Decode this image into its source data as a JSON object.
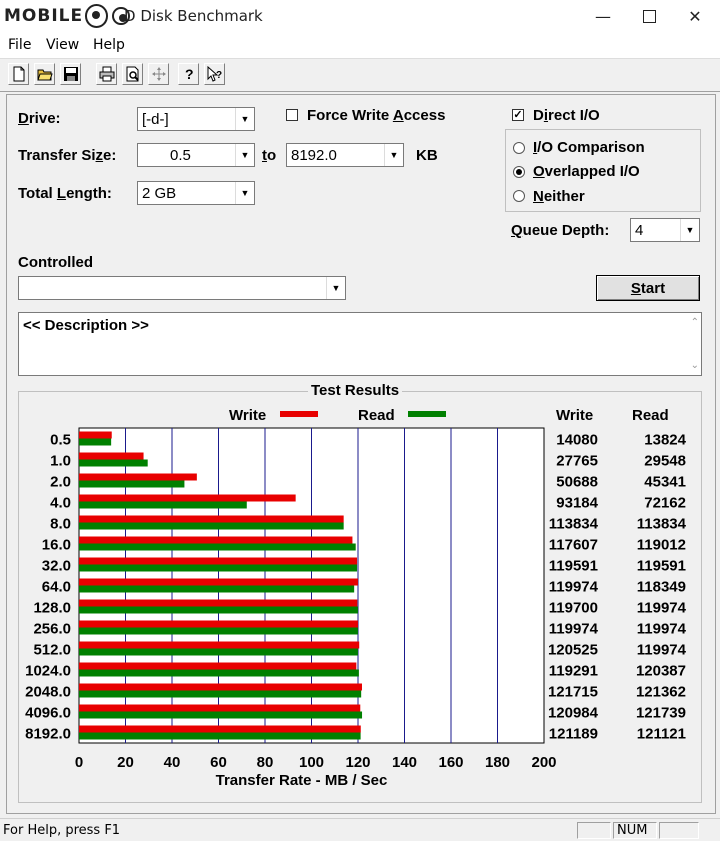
{
  "window": {
    "title": "D Disk Benchmark"
  },
  "menu": {
    "file": "File",
    "view": "View",
    "help": "Help"
  },
  "toolbar_icons": [
    "new-icon",
    "open-icon",
    "save-icon",
    "print-icon",
    "print-preview-icon",
    "move-icon",
    "help-icon",
    "context-help-icon"
  ],
  "settings": {
    "drive_label": "Drive:",
    "drive_value": "[-d-]",
    "force_write_label": "Force Write Access",
    "force_write_checked": false,
    "direct_io_label": "Direct I/O",
    "direct_io_checked": true,
    "transfer_size_label": "Transfer Size:",
    "transfer_from": "0.5",
    "to_label": "to",
    "transfer_to": "8192.0",
    "kb_label": "KB",
    "total_length_label": "Total Length:",
    "total_length_value": "2 GB",
    "io_comparison": "I/O Comparison",
    "overlapped_io": "Overlapped I/O",
    "neither": "Neither",
    "selected_mode": "Overlapped I/O",
    "queue_depth_label": "Queue Depth:",
    "queue_depth_value": "4",
    "controlled_label": "Controlled",
    "controlled_value": "",
    "start_label": "Start",
    "description": "<< Description >>"
  },
  "results": {
    "group_title": "Test Results",
    "write_header": "Write",
    "read_header": "Read"
  },
  "chart_data": {
    "type": "bar",
    "orientation": "horizontal",
    "categories": [
      "0.5",
      "1.0",
      "2.0",
      "4.0",
      "8.0",
      "16.0",
      "32.0",
      "64.0",
      "128.0",
      "256.0",
      "512.0",
      "1024.0",
      "2048.0",
      "4096.0",
      "8192.0"
    ],
    "series": [
      {
        "name": "Write",
        "color": "#e80000",
        "values": [
          14080,
          27765,
          50688,
          93184,
          113834,
          117607,
          119591,
          119974,
          119700,
          119974,
          120525,
          119291,
          121715,
          120984,
          121189
        ]
      },
      {
        "name": "Read",
        "color": "#008000",
        "values": [
          13824,
          29548,
          45341,
          72162,
          113834,
          119012,
          119591,
          118349,
          119974,
          119974,
          119974,
          120387,
          121362,
          121739,
          121121
        ]
      }
    ],
    "xlabel": "Transfer Rate - MB / Sec",
    "xticks": [
      "0",
      "20",
      "40",
      "60",
      "80",
      "100",
      "120",
      "140",
      "160",
      "180",
      "200"
    ],
    "xlim": [
      0,
      200
    ],
    "bar_unit": "KB/s",
    "grid": true,
    "legend": "top"
  },
  "status": {
    "help_text": "For Help, press F1",
    "num": "NUM"
  }
}
